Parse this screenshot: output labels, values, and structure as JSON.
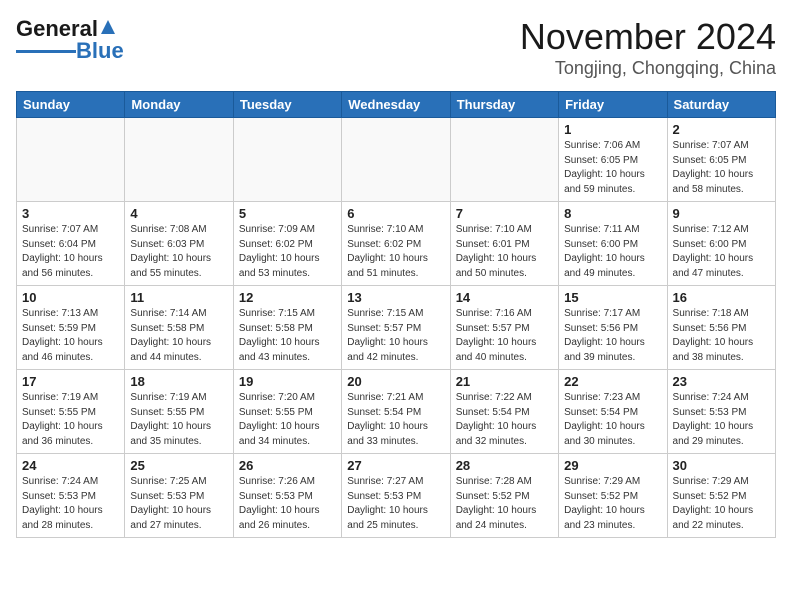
{
  "logo": {
    "line1": "General",
    "line2": "Blue"
  },
  "title": "November 2024",
  "subtitle": "Tongjing, Chongqing, China",
  "weekdays": [
    "Sunday",
    "Monday",
    "Tuesday",
    "Wednesday",
    "Thursday",
    "Friday",
    "Saturday"
  ],
  "weeks": [
    [
      {
        "day": "",
        "info": ""
      },
      {
        "day": "",
        "info": ""
      },
      {
        "day": "",
        "info": ""
      },
      {
        "day": "",
        "info": ""
      },
      {
        "day": "",
        "info": ""
      },
      {
        "day": "1",
        "info": "Sunrise: 7:06 AM\nSunset: 6:05 PM\nDaylight: 10 hours\nand 59 minutes."
      },
      {
        "day": "2",
        "info": "Sunrise: 7:07 AM\nSunset: 6:05 PM\nDaylight: 10 hours\nand 58 minutes."
      }
    ],
    [
      {
        "day": "3",
        "info": "Sunrise: 7:07 AM\nSunset: 6:04 PM\nDaylight: 10 hours\nand 56 minutes."
      },
      {
        "day": "4",
        "info": "Sunrise: 7:08 AM\nSunset: 6:03 PM\nDaylight: 10 hours\nand 55 minutes."
      },
      {
        "day": "5",
        "info": "Sunrise: 7:09 AM\nSunset: 6:02 PM\nDaylight: 10 hours\nand 53 minutes."
      },
      {
        "day": "6",
        "info": "Sunrise: 7:10 AM\nSunset: 6:02 PM\nDaylight: 10 hours\nand 51 minutes."
      },
      {
        "day": "7",
        "info": "Sunrise: 7:10 AM\nSunset: 6:01 PM\nDaylight: 10 hours\nand 50 minutes."
      },
      {
        "day": "8",
        "info": "Sunrise: 7:11 AM\nSunset: 6:00 PM\nDaylight: 10 hours\nand 49 minutes."
      },
      {
        "day": "9",
        "info": "Sunrise: 7:12 AM\nSunset: 6:00 PM\nDaylight: 10 hours\nand 47 minutes."
      }
    ],
    [
      {
        "day": "10",
        "info": "Sunrise: 7:13 AM\nSunset: 5:59 PM\nDaylight: 10 hours\nand 46 minutes."
      },
      {
        "day": "11",
        "info": "Sunrise: 7:14 AM\nSunset: 5:58 PM\nDaylight: 10 hours\nand 44 minutes."
      },
      {
        "day": "12",
        "info": "Sunrise: 7:15 AM\nSunset: 5:58 PM\nDaylight: 10 hours\nand 43 minutes."
      },
      {
        "day": "13",
        "info": "Sunrise: 7:15 AM\nSunset: 5:57 PM\nDaylight: 10 hours\nand 42 minutes."
      },
      {
        "day": "14",
        "info": "Sunrise: 7:16 AM\nSunset: 5:57 PM\nDaylight: 10 hours\nand 40 minutes."
      },
      {
        "day": "15",
        "info": "Sunrise: 7:17 AM\nSunset: 5:56 PM\nDaylight: 10 hours\nand 39 minutes."
      },
      {
        "day": "16",
        "info": "Sunrise: 7:18 AM\nSunset: 5:56 PM\nDaylight: 10 hours\nand 38 minutes."
      }
    ],
    [
      {
        "day": "17",
        "info": "Sunrise: 7:19 AM\nSunset: 5:55 PM\nDaylight: 10 hours\nand 36 minutes."
      },
      {
        "day": "18",
        "info": "Sunrise: 7:19 AM\nSunset: 5:55 PM\nDaylight: 10 hours\nand 35 minutes."
      },
      {
        "day": "19",
        "info": "Sunrise: 7:20 AM\nSunset: 5:55 PM\nDaylight: 10 hours\nand 34 minutes."
      },
      {
        "day": "20",
        "info": "Sunrise: 7:21 AM\nSunset: 5:54 PM\nDaylight: 10 hours\nand 33 minutes."
      },
      {
        "day": "21",
        "info": "Sunrise: 7:22 AM\nSunset: 5:54 PM\nDaylight: 10 hours\nand 32 minutes."
      },
      {
        "day": "22",
        "info": "Sunrise: 7:23 AM\nSunset: 5:54 PM\nDaylight: 10 hours\nand 30 minutes."
      },
      {
        "day": "23",
        "info": "Sunrise: 7:24 AM\nSunset: 5:53 PM\nDaylight: 10 hours\nand 29 minutes."
      }
    ],
    [
      {
        "day": "24",
        "info": "Sunrise: 7:24 AM\nSunset: 5:53 PM\nDaylight: 10 hours\nand 28 minutes."
      },
      {
        "day": "25",
        "info": "Sunrise: 7:25 AM\nSunset: 5:53 PM\nDaylight: 10 hours\nand 27 minutes."
      },
      {
        "day": "26",
        "info": "Sunrise: 7:26 AM\nSunset: 5:53 PM\nDaylight: 10 hours\nand 26 minutes."
      },
      {
        "day": "27",
        "info": "Sunrise: 7:27 AM\nSunset: 5:53 PM\nDaylight: 10 hours\nand 25 minutes."
      },
      {
        "day": "28",
        "info": "Sunrise: 7:28 AM\nSunset: 5:52 PM\nDaylight: 10 hours\nand 24 minutes."
      },
      {
        "day": "29",
        "info": "Sunrise: 7:29 AM\nSunset: 5:52 PM\nDaylight: 10 hours\nand 23 minutes."
      },
      {
        "day": "30",
        "info": "Sunrise: 7:29 AM\nSunset: 5:52 PM\nDaylight: 10 hours\nand 22 minutes."
      }
    ]
  ]
}
